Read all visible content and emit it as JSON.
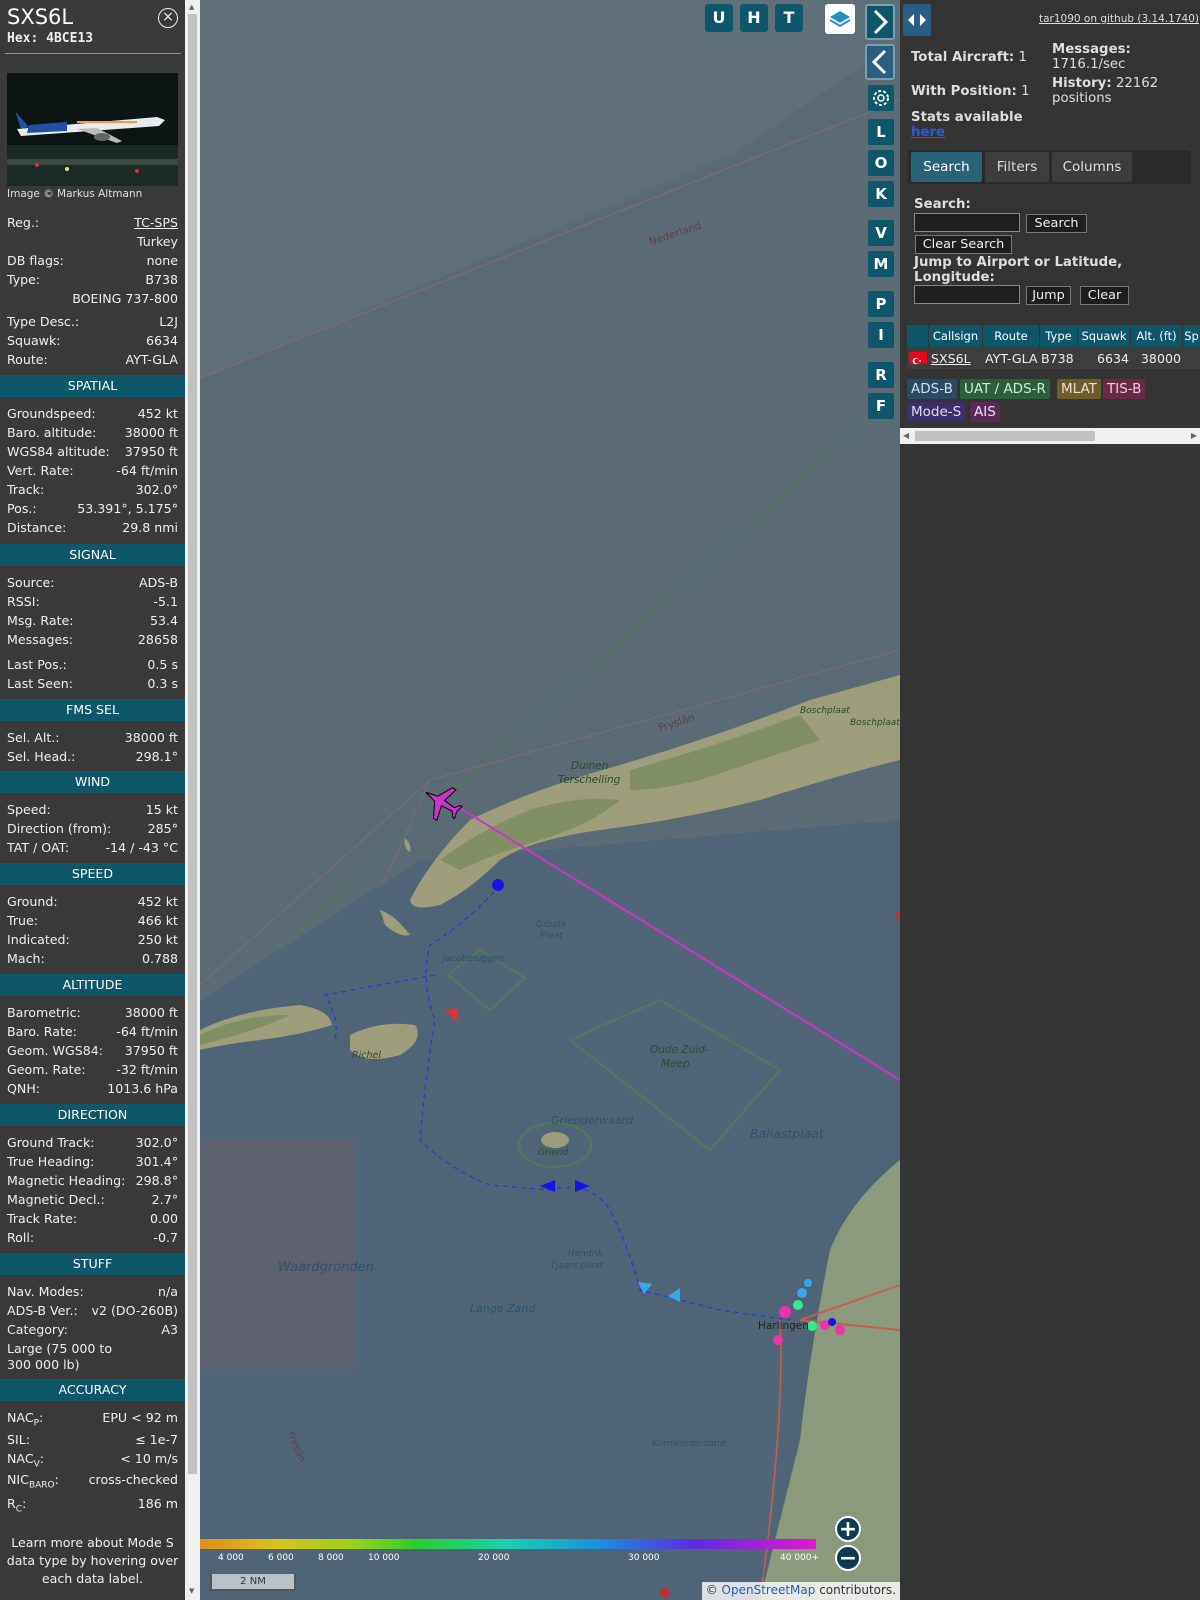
{
  "aircraft": {
    "callsign": "SXS6L",
    "hex": "Hex: 4BCE13",
    "photo_credit": "Image © Markus Altmann",
    "close_icon": "×"
  },
  "details": {
    "reg_k": "Reg.:",
    "reg_v": "TC-SPS",
    "country_v": "Turkey",
    "dbflags_k": "DB flags:",
    "dbflags_v": "none",
    "type_k": "Type:",
    "type_v": "B738",
    "typename_v": "BOEING 737-800",
    "typedesc_k": "Type Desc.:",
    "typedesc_v": "L2J",
    "squawk_k": "Squawk:",
    "squawk_v": "6634",
    "route_k": "Route:",
    "route_v": "AYT-GLA"
  },
  "sections": {
    "spatial": "SPATIAL",
    "signal": "SIGNAL",
    "fms": "FMS SEL",
    "wind": "WIND",
    "speed": "SPEED",
    "altitude": "ALTITUDE",
    "direction": "DIRECTION",
    "stuff": "STUFF",
    "accuracy": "ACCURACY"
  },
  "spatial": {
    "gs_k": "Groundspeed:",
    "gs_v": "452 kt",
    "baro_k": "Baro. altitude:",
    "baro_v": "38000 ft",
    "wgs_k": "WGS84 altitude:",
    "wgs_v": "37950 ft",
    "vr_k": "Vert. Rate:",
    "vr_v": "-64 ft/min",
    "trk_k": "Track:",
    "trk_v": "302.0°",
    "pos_k": "Pos.:",
    "pos_v": "53.391°, 5.175°",
    "dist_k": "Distance:",
    "dist_v": "29.8 nmi"
  },
  "signal": {
    "src_k": "Source:",
    "src_v": "ADS-B",
    "rssi_k": "RSSI:",
    "rssi_v": "-5.1",
    "rate_k": "Msg. Rate:",
    "rate_v": "53.4",
    "msgs_k": "Messages:",
    "msgs_v": "28658",
    "lpos_k": "Last Pos.:",
    "lpos_v": "0.5 s",
    "lseen_k": "Last Seen:",
    "lseen_v": "0.3 s"
  },
  "fms": {
    "alt_k": "Sel. Alt.:",
    "alt_v": "38000 ft",
    "head_k": "Sel. Head.:",
    "head_v": "298.1°"
  },
  "wind": {
    "spd_k": "Speed:",
    "spd_v": "15 kt",
    "dir_k": "Direction (from):",
    "dir_v": "285°",
    "tat_k": "TAT / OAT:",
    "tat_v": "-14 / -43 °C"
  },
  "speed": {
    "gnd_k": "Ground:",
    "gnd_v": "452 kt",
    "true_k": "True:",
    "true_v": "466 kt",
    "ind_k": "Indicated:",
    "ind_v": "250 kt",
    "mach_k": "Mach:",
    "mach_v": "0.788"
  },
  "altitude": {
    "baro_k": "Barometric:",
    "baro_v": "38000 ft",
    "brate_k": "Baro. Rate:",
    "brate_v": "-64 ft/min",
    "geom_k": "Geom. WGS84:",
    "geom_v": "37950 ft",
    "grate_k": "Geom. Rate:",
    "grate_v": "-32 ft/min",
    "qnh_k": "QNH:",
    "qnh_v": "1013.6 hPa"
  },
  "direction": {
    "gt_k": "Ground Track:",
    "gt_v": "302.0°",
    "th_k": "True Heading:",
    "th_v": "301.4°",
    "mh_k": "Magnetic Heading:",
    "mh_v": "298.8°",
    "md_k": "Magnetic Decl.:",
    "md_v": "2.7°",
    "tr_k": "Track Rate:",
    "tr_v": "0.00",
    "roll_k": "Roll:",
    "roll_v": "-0.7"
  },
  "stuff": {
    "nav_k": "Nav. Modes:",
    "nav_v": "n/a",
    "adsb_k": "ADS-B Ver.:",
    "adsb_v": "v2 (DO-260B)",
    "cat_k": "Category:",
    "cat_v": "A3",
    "catdesc_1": "Large (75 000 to",
    "catdesc_2": "300 000 lb)"
  },
  "accuracy": {
    "nacp_k": "NAC",
    "nacp_sub": "P",
    "nacp_v": "EPU < 92 m",
    "sil_k": "SIL:",
    "sil_v": "≤ 1e-7",
    "nacv_k": "NAC",
    "nacv_sub": "V",
    "nacv_v": "< 10 m/s",
    "nic_k": "NIC",
    "nic_sub": "BARO",
    "nic_v": "cross-checked",
    "rc_k": "R",
    "rc_sub": "C",
    "rc_v": "186 m"
  },
  "help_text_1": "Learn more about Mode S",
  "help_text_2": "data type by hovering over",
  "help_text_3": "each data label.",
  "map": {
    "top_buttons": [
      "U",
      "H",
      "T"
    ],
    "side_buttons": [
      "L",
      "O",
      "K",
      "V",
      "M",
      "P",
      "I",
      "R",
      "F"
    ],
    "labels": {
      "nederland": "Nederland",
      "fryslan": "Fryslân",
      "duinen1": "Duinen",
      "duinen2": "Terschelling",
      "boschplaat": "Boschplaat",
      "boschplaat2": "Boschplaat",
      "groote1": "Groote",
      "groote2": "Plaat",
      "jacobs": "Jacobsruggen",
      "richel": "Richel",
      "oude1": "Oude Zuid-",
      "oude2": "Meep",
      "griend": "Griend",
      "griendwaard": "Grienderwaard",
      "ballast": "Ballastplaat",
      "hendrik1": "Hendrik",
      "hendrik2": "Tjaars plaat",
      "waard": "Waardgronden",
      "lange": "Lange Zand",
      "harlingen": "Harlingen",
      "korn": "Kornwerderzand",
      "fryslan2": "Fryslân"
    },
    "colorbar": [
      "4 000",
      "6 000",
      "8 000",
      "10 000",
      "20 000",
      "30 000",
      "40 000+"
    ],
    "scale": "2 NM",
    "attribution_pre": "© ",
    "attribution_link": "OpenStreetMap",
    "attribution_post": " contributors."
  },
  "right": {
    "github": "tar1090 on github (3.14.1740)",
    "total_k": "Total Aircraft:",
    "total_v": "1",
    "withpos_k": "With Position:",
    "withpos_v": "1",
    "msgs_k": "Messages:",
    "msgs_v": "1716.1/sec",
    "hist_k": "History:",
    "hist_v1": "22162",
    "hist_v2": "positions",
    "stats": "Stats available",
    "stats_link": "here",
    "tabs": [
      "Search",
      "Filters",
      "Columns"
    ],
    "search_label": "Search:",
    "search_btn": "Search",
    "clear_search_btn": "Clear Search",
    "jump_label_1": "Jump to Airport or Latitude,",
    "jump_label_2": "Longitude:",
    "jump_btn": "Jump",
    "clear_btn": "Clear",
    "columns": [
      "Callsign",
      "Route",
      "Type",
      "Squawk",
      "Alt. (ft)",
      "Sp"
    ],
    "row": {
      "callsign": "SXS6L",
      "route": "AYT-GLA",
      "type": "B738",
      "squawk": "6634",
      "alt": "38000"
    },
    "badges": [
      "ADS-B",
      "UAT / ADS-R",
      "MLAT",
      "TIS-B",
      "Mode-S",
      "AIS"
    ]
  },
  "colors": {
    "accent": "#0e5669",
    "track": "#cc33cc",
    "tab_active": "#2a6277",
    "adsb_badge": "#2b4a63",
    "uat_badge": "#2d5e3e",
    "mlat_badge": "#6b5c2b",
    "tisb_badge": "#6b2b47",
    "modes_badge": "#3c2f6b",
    "ais_badge": "#5a2b5a"
  }
}
